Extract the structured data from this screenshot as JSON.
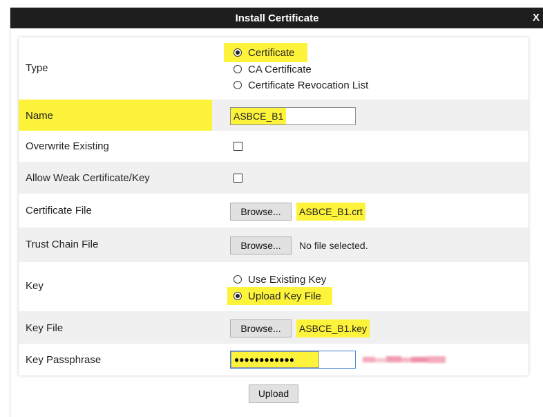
{
  "dialog": {
    "title": "Install Certificate",
    "close_label": "X"
  },
  "form": {
    "type": {
      "label": "Type",
      "options": [
        {
          "label": "Certificate",
          "selected": true
        },
        {
          "label": "CA Certificate",
          "selected": false
        },
        {
          "label": "Certificate Revocation List",
          "selected": false
        }
      ]
    },
    "name": {
      "label": "Name",
      "value": "ASBCE_B1"
    },
    "overwrite": {
      "label": "Overwrite Existing",
      "checked": false
    },
    "weak": {
      "label": "Allow Weak Certificate/Key",
      "checked": false
    },
    "cert_file": {
      "label": "Certificate File",
      "browse_label": "Browse...",
      "file": "ASBCE_B1.crt"
    },
    "trust_chain": {
      "label": "Trust Chain File",
      "browse_label": "Browse...",
      "file": "No file selected."
    },
    "key": {
      "label": "Key",
      "options": [
        {
          "label": "Use Existing Key",
          "selected": false
        },
        {
          "label": "Upload Key File",
          "selected": true
        }
      ]
    },
    "key_file": {
      "label": "Key File",
      "browse_label": "Browse...",
      "file": "ASBCE_B1.key"
    },
    "passphrase": {
      "label": "Key Passphrase",
      "masked_value": "●●●●●●●●●●●●"
    }
  },
  "actions": {
    "upload_label": "Upload"
  },
  "colors": {
    "titlebar": "#1e1e1e",
    "highlight": "#fdf33a",
    "row_shade": "#f0f0f0"
  }
}
